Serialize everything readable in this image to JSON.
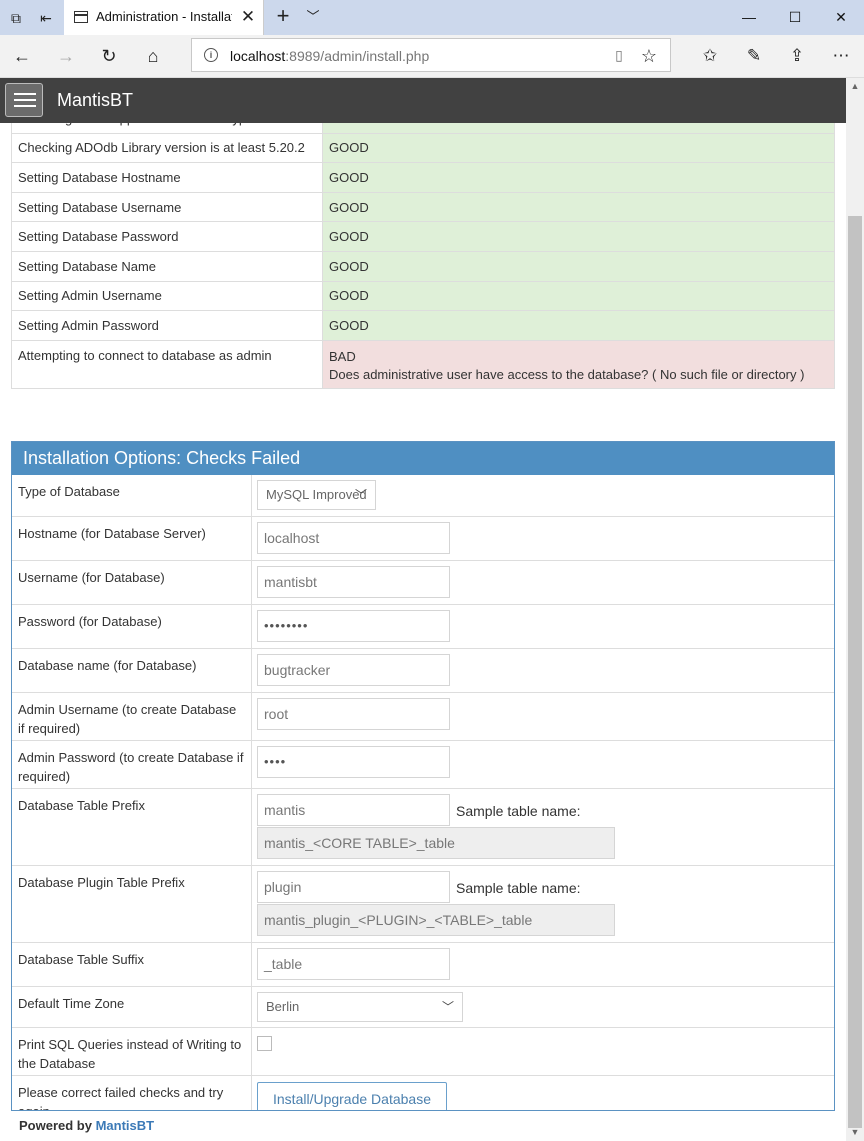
{
  "browser": {
    "tab_title": "Administration - Installation",
    "url_host": "localhost",
    "url_path": ":8989/admin/install.php"
  },
  "app": {
    "brand": "MantisBT"
  },
  "checks": [
    {
      "label": "Checking PHP support for database type",
      "status": "GOOD"
    },
    {
      "label": "Checking ADOdb Library version is at least 5.20.2",
      "status": "GOOD"
    },
    {
      "label": "Setting Database Hostname",
      "status": "GOOD"
    },
    {
      "label": "Setting Database Username",
      "status": "GOOD"
    },
    {
      "label": "Setting Database Password",
      "status": "GOOD"
    },
    {
      "label": "Setting Database Name",
      "status": "GOOD"
    },
    {
      "label": "Setting Admin Username",
      "status": "GOOD"
    },
    {
      "label": "Setting Admin Password",
      "status": "GOOD"
    },
    {
      "label": "Attempting to connect to database as admin",
      "status": "BAD",
      "detail": "Does administrative user have access to the database? ( No such file or directory )"
    }
  ],
  "options": {
    "title": "Installation Options: Checks Failed",
    "db_type_label": "Type of Database",
    "db_type_value": "MySQL Improved",
    "hostname_label": "Hostname (for Database Server)",
    "hostname_value": "localhost",
    "username_label": "Username (for Database)",
    "username_value": "mantisbt",
    "password_label": "Password (for Database)",
    "password_value": "••••••••",
    "dbname_label": "Database name (for Database)",
    "dbname_value": "bugtracker",
    "admin_user_label": "Admin Username (to create Database if required)",
    "admin_user_value": "root",
    "admin_pass_label": "Admin Password (to create Database if required)",
    "admin_pass_value": "••••",
    "prefix_label": "Database Table Prefix",
    "prefix_value": "mantis",
    "sample_label": "Sample table name:",
    "prefix_sample": "mantis_<CORE TABLE>_table",
    "plugin_prefix_label": "Database Plugin Table Prefix",
    "plugin_prefix_value": "plugin",
    "plugin_sample": "mantis_plugin_<PLUGIN>_<TABLE>_table",
    "suffix_label": "Database Table Suffix",
    "suffix_value": "_table",
    "timezone_label": "Default Time Zone",
    "timezone_value": "Berlin",
    "print_sql_label": "Print SQL Queries instead of Writing to the Database",
    "submit_label_text": "Please correct failed checks and try again",
    "submit_button": "Install/Upgrade Database"
  },
  "footer": {
    "powered_by": "Powered by",
    "powered_link": "MantisBT"
  }
}
